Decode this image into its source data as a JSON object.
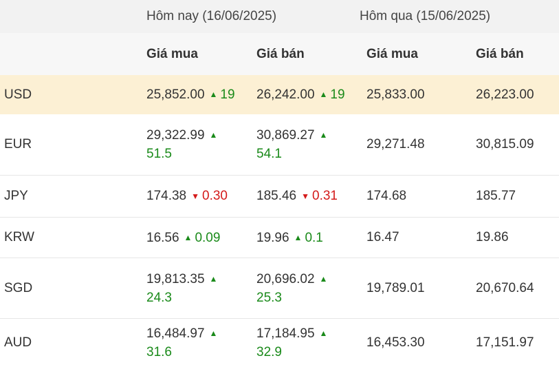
{
  "header": {
    "today": "Hôm nay (16/06/2025)",
    "yesterday": "Hôm qua (15/06/2025)",
    "cols": [
      "Giá mua",
      "Giá bán",
      "Giá mua",
      "Giá bán"
    ]
  },
  "rows": [
    {
      "code": "USD",
      "buy": "25,852.00",
      "buy_dir": "up",
      "buy_chg": "19",
      "sell": "26,242.00",
      "sell_dir": "up",
      "sell_chg": "19",
      "prev_buy": "25,833.00",
      "prev_sell": "26,223.00",
      "highlight": true,
      "wrap": false
    },
    {
      "code": "EUR",
      "buy": "29,322.99",
      "buy_dir": "up",
      "buy_chg": "51.5",
      "sell": "30,869.27",
      "sell_dir": "up",
      "sell_chg": "54.1",
      "prev_buy": "29,271.48",
      "prev_sell": "30,815.09",
      "highlight": false,
      "wrap": true
    },
    {
      "code": "JPY",
      "buy": "174.38",
      "buy_dir": "down",
      "buy_chg": "0.30",
      "sell": "185.46",
      "sell_dir": "down",
      "sell_chg": "0.31",
      "prev_buy": "174.68",
      "prev_sell": "185.77",
      "highlight": false,
      "wrap": false
    },
    {
      "code": "KRW",
      "buy": "16.56",
      "buy_dir": "up",
      "buy_chg": "0.09",
      "sell": "19.96",
      "sell_dir": "up",
      "sell_chg": "0.1",
      "prev_buy": "16.47",
      "prev_sell": "19.86",
      "highlight": false,
      "wrap": false
    },
    {
      "code": "SGD",
      "buy": "19,813.35",
      "buy_dir": "up",
      "buy_chg": "24.3",
      "sell": "20,696.02",
      "sell_dir": "up",
      "sell_chg": "25.3",
      "prev_buy": "19,789.01",
      "prev_sell": "20,670.64",
      "highlight": false,
      "wrap": true
    },
    {
      "code": "AUD",
      "buy": "16,484.97",
      "buy_dir": "up",
      "buy_chg": "31.6",
      "sell": "17,184.95",
      "sell_dir": "up",
      "sell_chg": "32.9",
      "prev_buy": "16,453.30",
      "prev_sell": "17,151.97",
      "highlight": false,
      "wrap": true
    }
  ],
  "icons": {
    "up": "triangle-up-icon",
    "down": "triangle-down-icon"
  },
  "colors": {
    "up": "#1a8a1a",
    "down": "#d41a1a",
    "highlight_row": "#fcf0d4",
    "header_bg": "#f2f2f2"
  }
}
